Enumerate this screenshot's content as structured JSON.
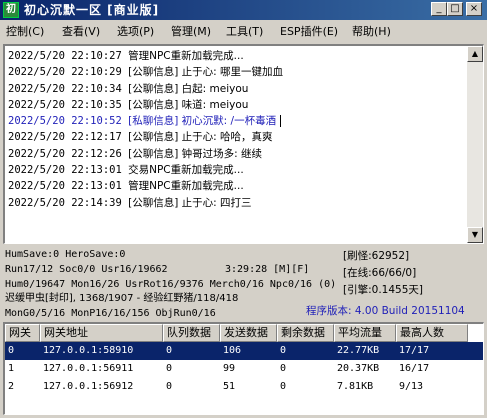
{
  "window": {
    "title": "初心沉默一区 [商业版]",
    "controls": {
      "minimize": "_",
      "maximize": "□",
      "close": "×"
    }
  },
  "menu": [
    {
      "label": "控制(C)"
    },
    {
      "label": "查看(V)"
    },
    {
      "label": "选项(P)"
    },
    {
      "label": "管理(M)"
    },
    {
      "label": "工具(T)"
    },
    {
      "label": "ESP插件(E)"
    },
    {
      "label": "帮助(H)"
    }
  ],
  "log": [
    {
      "time": "2022/5/20 22:10:27",
      "msg": "管理NPC重新加载完成...",
      "private": false
    },
    {
      "time": "2022/5/20 22:10:29",
      "msg": "[公聊信息] 止于心: 哪里一键加血",
      "private": false
    },
    {
      "time": "2022/5/20 22:10:34",
      "msg": "[公聊信息] 白起: meiyou",
      "private": false
    },
    {
      "time": "2022/5/20 22:10:35",
      "msg": "[公聊信息] 味道: meiyou",
      "private": false
    },
    {
      "time": "2022/5/20 22:10:52",
      "msg": "[私聊信息] 初心沉默: /一杯毒酒",
      "private": true
    },
    {
      "time": "2022/5/20 22:12:17",
      "msg": "[公聊信息] 止于心: 哈哈，真爽",
      "private": false
    },
    {
      "time": "2022/5/20 22:12:26",
      "msg": "[公聊信息] 钟哥过场多: 继续",
      "private": false
    },
    {
      "time": "2022/5/20 22:13:01",
      "msg": "交易NPC重新加载完成...",
      "private": false
    },
    {
      "time": "2022/5/20 22:13:01",
      "msg": "管理NPC重新加载完成...",
      "private": false
    },
    {
      "time": "2022/5/20 22:14:39",
      "msg": "[公聊信息] 止于心: 四打三",
      "private": false
    }
  ],
  "stats": {
    "line1": "HumSave:0 HeroSave:0",
    "line2a": "Run17/12 Soc0/0 Usr16/19662",
    "line2b": "3:29:28 [M][F]",
    "line3": "Hum0/19647 Mon16/26 UsrRot16/9376 Merch0/16 Npc0/16 (0)",
    "line4": "迟缓甲虫[封印], 1368/1907 - 经验红野猪/118/418",
    "line5": "MonG0/5/16 MonP16/16/156 ObjRun0/16",
    "refresh": "[刷怪:62952]",
    "online": "[在线:66/66/0]",
    "ratio": "[引擎:0.1455天]",
    "version": "程序版本: 4.00 Build 20151104"
  },
  "table": {
    "headers": [
      "网关",
      "网关地址",
      "队列数据",
      "发送数据",
      "剩余数据",
      "平均流量",
      "最高人数"
    ],
    "rows": [
      [
        "0",
        "127.0.0.1:58910",
        "0",
        "106",
        "0",
        "22.77KB",
        "17/17"
      ],
      [
        "1",
        "127.0.0.1:56911",
        "0",
        "99",
        "0",
        "20.37KB",
        "16/17"
      ],
      [
        "2",
        "127.0.0.1:56912",
        "0",
        "51",
        "0",
        "7.81KB",
        "9/13"
      ]
    ],
    "selected_row": 0
  }
}
